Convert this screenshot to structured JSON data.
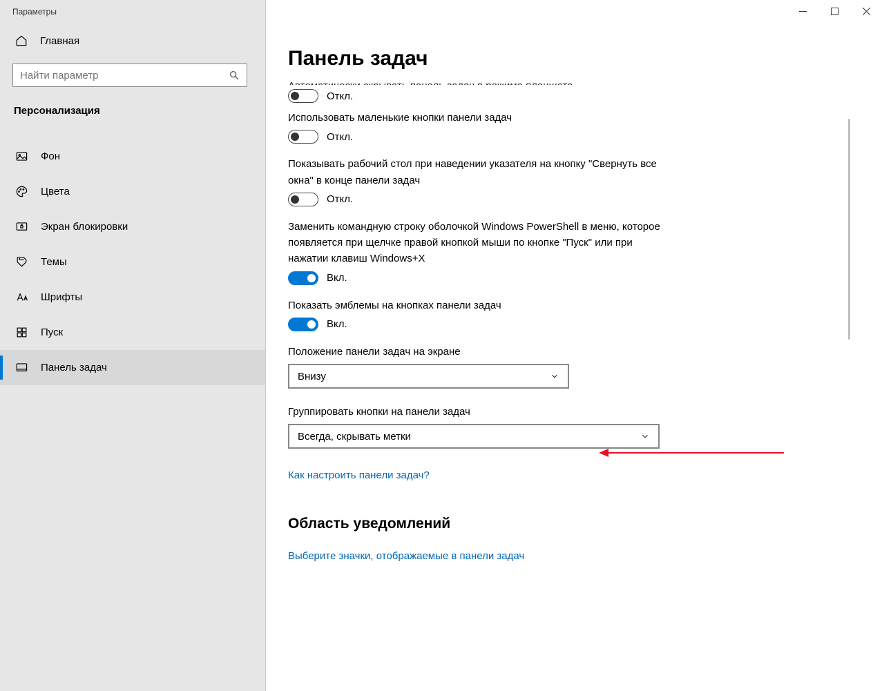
{
  "window": {
    "title": "Параметры"
  },
  "sidebar": {
    "home": "Главная",
    "search_placeholder": "Найти параметр",
    "section": "Персонализация",
    "items": [
      {
        "key": "background",
        "label": "Фон"
      },
      {
        "key": "colors",
        "label": "Цвета"
      },
      {
        "key": "lockscreen",
        "label": "Экран блокировки"
      },
      {
        "key": "themes",
        "label": "Темы"
      },
      {
        "key": "fonts",
        "label": "Шрифты"
      },
      {
        "key": "start",
        "label": "Пуск"
      },
      {
        "key": "taskbar",
        "label": "Панель задач"
      }
    ],
    "selected": "taskbar"
  },
  "page": {
    "title": "Панель задач",
    "truncated_top_label": "Автоматически скрывать панель задач в режиме планшета",
    "settings": [
      {
        "key": "tablet_hide",
        "label": "",
        "state": "off",
        "state_text": "Откл."
      },
      {
        "key": "small_buttons",
        "label": "Использовать маленькие кнопки панели задач",
        "state": "off",
        "state_text": "Откл."
      },
      {
        "key": "peek_desktop",
        "label": "Показывать рабочий стол при наведении указателя на кнопку \"Свернуть все окна\" в конце панели задач",
        "state": "off",
        "state_text": "Откл."
      },
      {
        "key": "powershell",
        "label": "Заменить командную строку оболочкой Windows PowerShell в меню, которое появляется при щелчке правой кнопкой мыши по кнопке \"Пуск\" или при нажатии клавиш Windows+X",
        "state": "on",
        "state_text": "Вкл."
      },
      {
        "key": "badges",
        "label": "Показать эмблемы на кнопках панели задач",
        "state": "on",
        "state_text": "Вкл."
      }
    ],
    "dropdowns": [
      {
        "key": "position",
        "label": "Положение панели задач на экране",
        "value": "Внизу"
      },
      {
        "key": "combine",
        "label": "Группировать кнопки на панели задач",
        "value": "Всегда, скрывать метки"
      }
    ],
    "help_link": "Как настроить панели задач?",
    "section2_title": "Область уведомлений",
    "section2_link": "Выберите значки, отображаемые в панели задач"
  }
}
